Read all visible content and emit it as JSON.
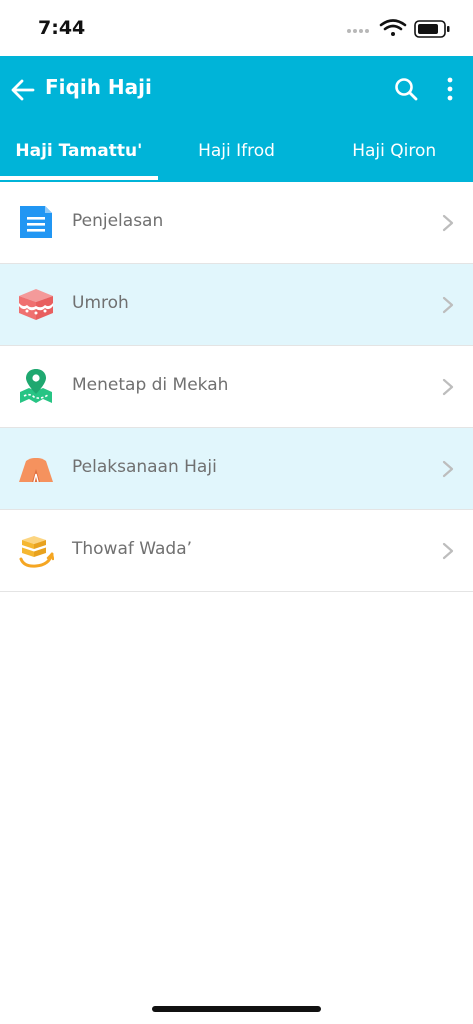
{
  "status_bar": {
    "time": "7:44",
    "icons": [
      "signal-dots-icon",
      "wifi-icon",
      "battery-icon"
    ]
  },
  "appbar": {
    "title": "Fiqih Haji",
    "background_color": "#00b4d8",
    "left_icon": "back-arrow-icon",
    "right_icons": [
      "search-icon",
      "more-vert-icon"
    ]
  },
  "tabs": [
    {
      "label": "Haji Tamattu'",
      "active": true
    },
    {
      "label": "Haji Ifrod",
      "active": false
    },
    {
      "label": "Haji Qiron",
      "active": false
    }
  ],
  "list": {
    "items": [
      {
        "label": "Penjelasan",
        "icon": "document-icon",
        "icon_color": "#2196f3"
      },
      {
        "label": "Umroh",
        "icon": "kaaba-icon",
        "icon_color": "#f07b7b"
      },
      {
        "label": "Menetap di Mekah",
        "icon": "map-pin-icon",
        "icon_color": "#2ecc8a"
      },
      {
        "label": "Pelaksanaan Haji",
        "icon": "tent-icon",
        "icon_color": "#f5925e"
      },
      {
        "label": "Thowaf Wada’",
        "icon": "kaaba-circle-icon",
        "icon_color": "#f5b731"
      }
    ],
    "alt_row_color": "#e1f6fc"
  }
}
